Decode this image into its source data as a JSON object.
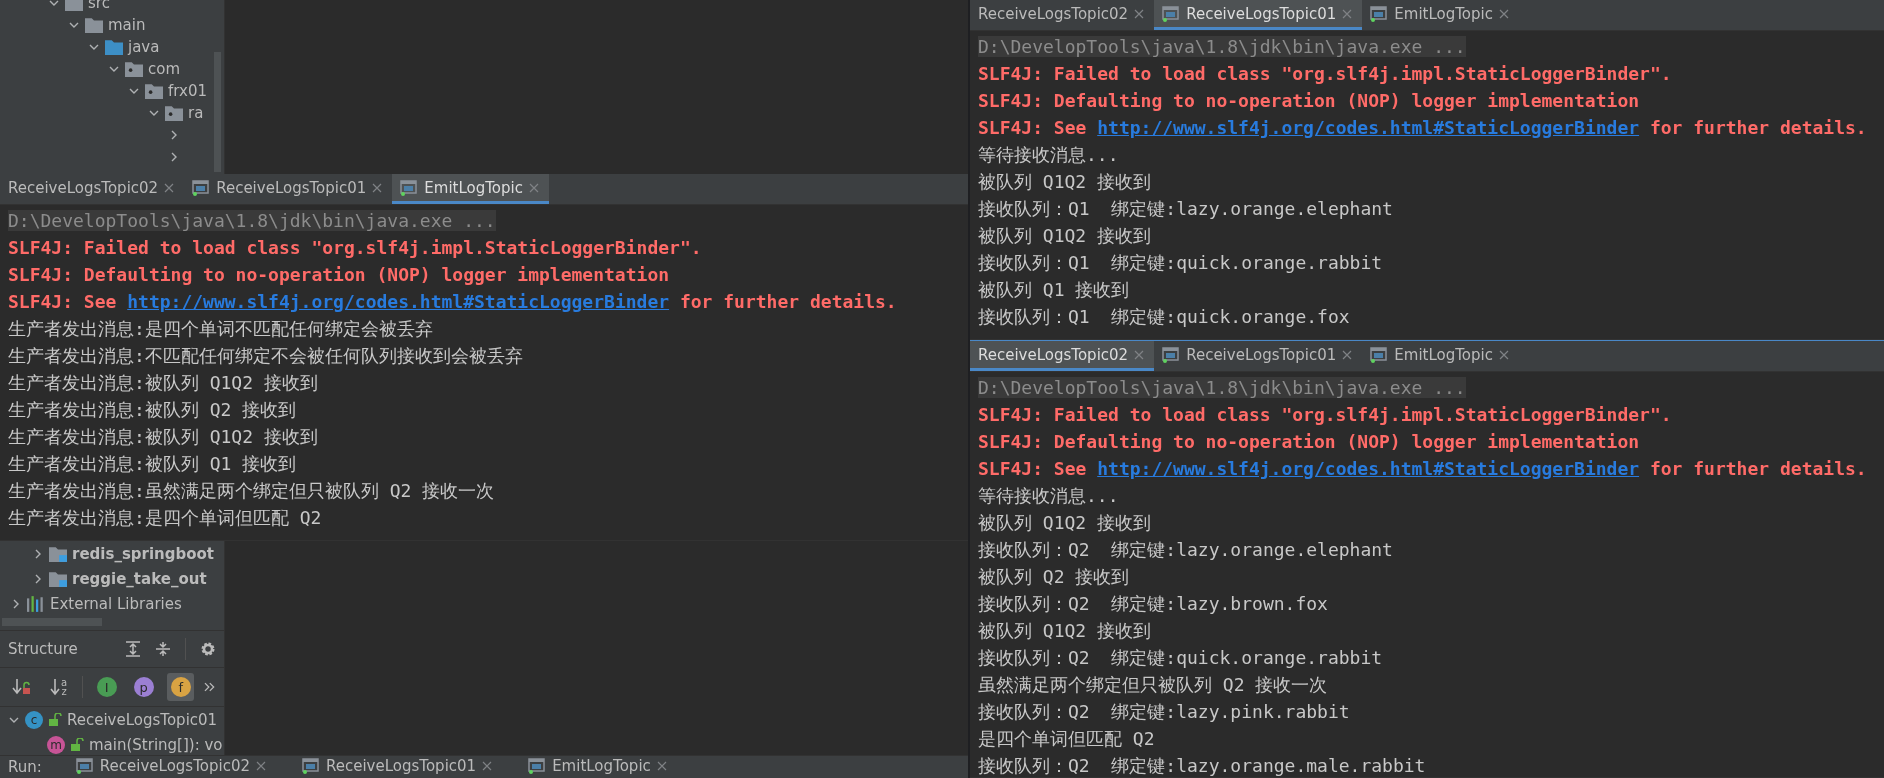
{
  "project_tree_top": {
    "items": [
      {
        "label": "src",
        "kind": "folder",
        "expanded": true,
        "children": [
          {
            "label": "main",
            "kind": "folder",
            "expanded": true,
            "children": [
              {
                "label": "java",
                "kind": "source_folder",
                "expanded": true,
                "children": [
                  {
                    "label": "com",
                    "kind": "package",
                    "expanded": true,
                    "children": [
                      {
                        "label": "frx01",
                        "kind": "package",
                        "expanded": true,
                        "children": [
                          {
                            "label": "ra",
                            "kind": "package",
                            "expanded": true,
                            "children": [
                              {
                                "expanded": false
                              },
                              {
                                "expanded": false
                              }
                            ]
                          }
                        ]
                      }
                    ]
                  }
                ]
              }
            ]
          }
        ]
      }
    ]
  },
  "left_console": {
    "tabs": [
      {
        "label": "ReceiveLogsTopic02",
        "icon": false,
        "selected": false
      },
      {
        "label": "ReceiveLogsTopic01",
        "icon": true,
        "selected": false
      },
      {
        "label": "EmitLogTopic",
        "icon": true,
        "selected": true
      }
    ],
    "lines": [
      {
        "kind": "command",
        "text": "D:\\DevelopTools\\java\\1.8\\jdk\\bin\\java.exe ..."
      },
      {
        "kind": "error",
        "text": "SLF4J: Failed to load class \"org.slf4j.impl.StaticLoggerBinder\"."
      },
      {
        "kind": "error",
        "text": "SLF4J: Defaulting to no-operation (NOP) logger implementation"
      },
      {
        "kind": "error_link",
        "text": "SLF4J: See ",
        "link": "http://www.slf4j.org/codes.html#StaticLoggerBinder",
        "after": " for further details."
      },
      {
        "kind": "output",
        "text": "生产者发出消息:是四个单词不匹配任何绑定会被丢弃"
      },
      {
        "kind": "output",
        "text": "生产者发出消息:不匹配任何绑定不会被任何队列接收到会被丢弃"
      },
      {
        "kind": "output",
        "text": "生产者发出消息:被队列 Q1Q2 接收到"
      },
      {
        "kind": "output",
        "text": "生产者发出消息:被队列 Q2 接收到"
      },
      {
        "kind": "output",
        "text": "生产者发出消息:被队列 Q1Q2 接收到"
      },
      {
        "kind": "output",
        "text": "生产者发出消息:被队列 Q1 接收到"
      },
      {
        "kind": "output",
        "text": "生产者发出消息:虽然满足两个绑定但只被队列 Q2 接收一次"
      },
      {
        "kind": "output",
        "text": "生产者发出消息:是四个单词但匹配 Q2"
      }
    ]
  },
  "project_tree_bottom": {
    "items": [
      {
        "children": [
          {
            "label": "redis_springboot",
            "kind": "module",
            "expanded": false
          },
          {
            "label": "reggie_take_out",
            "kind": "module",
            "expanded": false
          }
        ]
      },
      {
        "label": "External Libraries",
        "kind": "libraries",
        "expanded": false
      }
    ]
  },
  "structure": {
    "title": "Structure",
    "toolbar": [
      {
        "kind": "visibility_sort",
        "selected": false
      },
      {
        "kind": "alpha_sort",
        "glyph": "a",
        "glyph2": "z",
        "selected": false
      },
      {
        "kind": "inherited",
        "glyph": "I",
        "selected": false
      },
      {
        "kind": "properties",
        "glyph": "p",
        "selected": false
      },
      {
        "kind": "fields",
        "glyph": "f",
        "selected": true
      }
    ],
    "tree": [
      {
        "label": "ReceiveLogsTopic01",
        "badge": "c",
        "expanded": true,
        "children": [
          {
            "label": "main(String[]): vo",
            "badge": "m"
          }
        ]
      }
    ]
  },
  "run_bar": {
    "label": "Run:",
    "tabs": [
      {
        "label": "ReceiveLogsTopic02",
        "icon": true,
        "selected": false
      },
      {
        "label": "ReceiveLogsTopic01",
        "icon": true,
        "selected": false
      },
      {
        "label": "EmitLogTopic",
        "icon": true,
        "selected": false
      }
    ]
  },
  "right_top_console": {
    "tabs": [
      {
        "label": "ReceiveLogsTopic02",
        "icon": false,
        "selected": false
      },
      {
        "label": "ReceiveLogsTopic01",
        "icon": true,
        "selected": true
      },
      {
        "label": "EmitLogTopic",
        "icon": true,
        "selected": false
      }
    ],
    "lines": [
      {
        "kind": "command",
        "text": "D:\\DevelopTools\\java\\1.8\\jdk\\bin\\java.exe ..."
      },
      {
        "kind": "error",
        "text": "SLF4J: Failed to load class \"org.slf4j.impl.StaticLoggerBinder\"."
      },
      {
        "kind": "error",
        "text": "SLF4J: Defaulting to no-operation (NOP) logger implementation"
      },
      {
        "kind": "error_link",
        "text": "SLF4J: See ",
        "link": "http://www.slf4j.org/codes.html#StaticLoggerBinder",
        "after": " for further details."
      },
      {
        "kind": "output",
        "text": "等待接收消息..."
      },
      {
        "kind": "output",
        "text": "被队列 Q1Q2 接收到"
      },
      {
        "kind": "output",
        "text": "接收队列：Q1  绑定键:lazy.orange.elephant"
      },
      {
        "kind": "output",
        "text": "被队列 Q1Q2 接收到"
      },
      {
        "kind": "output",
        "text": "接收队列：Q1  绑定键:quick.orange.rabbit"
      },
      {
        "kind": "output",
        "text": "被队列 Q1 接收到"
      },
      {
        "kind": "output",
        "text": "接收队列：Q1  绑定键:quick.orange.fox"
      }
    ]
  },
  "right_bottom_console": {
    "tabs": [
      {
        "label": "ReceiveLogsTopic02",
        "icon": false,
        "selected": true
      },
      {
        "label": "ReceiveLogsTopic01",
        "icon": true,
        "selected": false
      },
      {
        "label": "EmitLogTopic",
        "icon": true,
        "selected": false
      }
    ],
    "lines": [
      {
        "kind": "command",
        "text": "D:\\DevelopTools\\java\\1.8\\jdk\\bin\\java.exe ..."
      },
      {
        "kind": "error",
        "text": "SLF4J: Failed to load class \"org.slf4j.impl.StaticLoggerBinder\"."
      },
      {
        "kind": "error",
        "text": "SLF4J: Defaulting to no-operation (NOP) logger implementation"
      },
      {
        "kind": "error_link",
        "text": "SLF4J: See ",
        "link": "http://www.slf4j.org/codes.html#StaticLoggerBinder",
        "after": " for further details."
      },
      {
        "kind": "output",
        "text": "等待接收消息..."
      },
      {
        "kind": "output",
        "text": "被队列 Q1Q2 接收到"
      },
      {
        "kind": "output",
        "text": "接收队列：Q2  绑定键:lazy.orange.elephant"
      },
      {
        "kind": "output",
        "text": "被队列 Q2 接收到"
      },
      {
        "kind": "output",
        "text": "接收队列：Q2  绑定键:lazy.brown.fox"
      },
      {
        "kind": "output",
        "text": "被队列 Q1Q2 接收到"
      },
      {
        "kind": "output",
        "text": "接收队列：Q2  绑定键:quick.orange.rabbit"
      },
      {
        "kind": "output",
        "text": "虽然满足两个绑定但只被队列 Q2 接收一次"
      },
      {
        "kind": "output",
        "text": "接收队列：Q2  绑定键:lazy.pink.rabbit"
      },
      {
        "kind": "output",
        "text": "是四个单词但匹配 Q2"
      },
      {
        "kind": "output",
        "text": "接收队列：Q2  绑定键:lazy.orange.male.rabbit"
      }
    ]
  }
}
